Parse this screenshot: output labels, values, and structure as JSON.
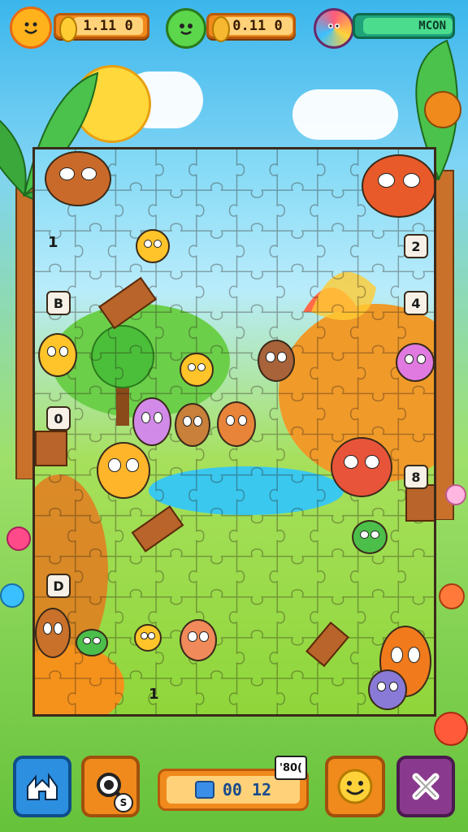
{
  "hud": {
    "coins_value": "1.11 0",
    "gems_value": "0.11 0",
    "mode_label": "MCON"
  },
  "board": {
    "numbers": [
      "1",
      "2",
      "B",
      "4",
      "0",
      "8",
      "D",
      "1"
    ]
  },
  "bottom_bar": {
    "score_value": "00 12",
    "score_tag": "'80(",
    "hint_badge": "S"
  },
  "colors": {
    "hud_orange": "#f08a1c",
    "hud_green": "#1fa37a",
    "home_button": "#2d8fe0",
    "close_button": "#8a3a8e"
  }
}
